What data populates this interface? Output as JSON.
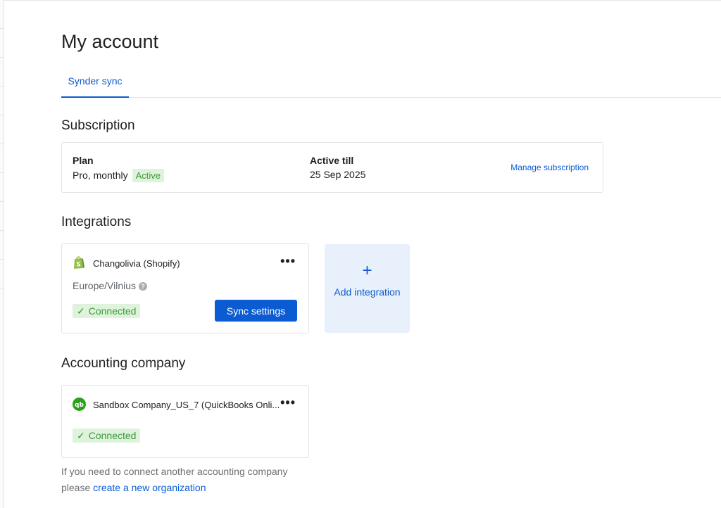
{
  "page": {
    "title": "My account"
  },
  "tabs": [
    {
      "label": "Synder sync",
      "active": true
    }
  ],
  "subscription": {
    "section_title": "Subscription",
    "plan_label": "Plan",
    "plan_value": "Pro, monthly",
    "status_badge": "Active",
    "active_till_label": "Active till",
    "active_till_value": "25 Sep 2025",
    "manage_link": "Manage subscription"
  },
  "integrations": {
    "section_title": "Integrations",
    "items": [
      {
        "name": "Changolivia (Shopify)",
        "icon": "shopify-icon",
        "timezone": "Europe/Vilnius",
        "status": "Connected",
        "action_label": "Sync settings"
      }
    ],
    "add": {
      "plus": "+",
      "label": "Add integration"
    }
  },
  "accounting": {
    "section_title": "Accounting company",
    "company": {
      "name": "Sandbox Company_US_7 (QuickBooks Onli...",
      "icon": "quickbooks-icon",
      "status": "Connected"
    },
    "note_text": "If you need to connect another accounting company",
    "note_prefix": "please",
    "note_link": "create a new organization"
  },
  "colors": {
    "accent": "#0b5bd3",
    "success_bg": "#dff3dc",
    "success_text": "#3a9a38",
    "add_bg": "#e8f0fb"
  }
}
